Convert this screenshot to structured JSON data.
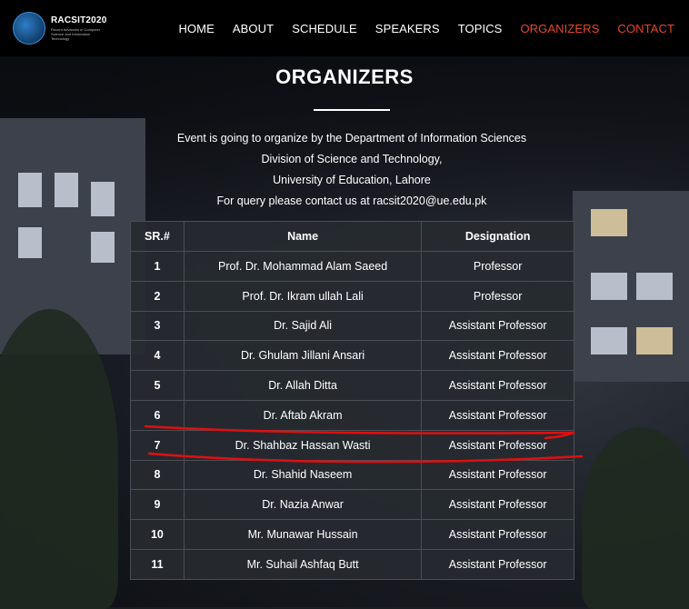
{
  "brand": {
    "title": "RACSIT2020",
    "subtitle": "Recent Advances in Computer Science and Information Technology"
  },
  "nav": {
    "items": [
      {
        "label": "HOME"
      },
      {
        "label": "ABOUT"
      },
      {
        "label": "SCHEDULE"
      },
      {
        "label": "SPEAKERS"
      },
      {
        "label": "TOPICS"
      },
      {
        "label": "ORGANIZERS",
        "active": true
      },
      {
        "label": "CONTACT"
      }
    ]
  },
  "page": {
    "heading": "ORGANIZERS",
    "intro": [
      "Event is going to organize by the Department of Information Sciences",
      "Division of Science and Technology,",
      "University of Education, Lahore",
      "For query please contact us at racsit2020@ue.edu.pk"
    ]
  },
  "table": {
    "headers": [
      "SR.#",
      "Name",
      "Designation"
    ],
    "rows": [
      {
        "sr": "1",
        "name": "Prof. Dr. Mohammad Alam Saeed",
        "designation": "Professor"
      },
      {
        "sr": "2",
        "name": "Prof. Dr. Ikram ullah Lali",
        "designation": "Professor"
      },
      {
        "sr": "3",
        "name": "Dr. Sajid Ali",
        "designation": "Assistant Professor"
      },
      {
        "sr": "4",
        "name": "Dr. Ghulam Jillani Ansari",
        "designation": "Assistant Professor"
      },
      {
        "sr": "5",
        "name": "Dr. Allah Ditta",
        "designation": "Assistant Professor"
      },
      {
        "sr": "6",
        "name": "Dr. Aftab Akram",
        "designation": "Assistant Professor"
      },
      {
        "sr": "7",
        "name": "Dr. Shahbaz Hassan Wasti",
        "designation": "Assistant Professor"
      },
      {
        "sr": "8",
        "name": "Dr. Shahid Naseem",
        "designation": "Assistant Professor"
      },
      {
        "sr": "9",
        "name": "Dr. Nazia Anwar",
        "designation": "Assistant Professor"
      },
      {
        "sr": "10",
        "name": "Mr. Munawar Hussain",
        "designation": "Assistant Professor"
      },
      {
        "sr": "11",
        "name": "Mr. Suhail Ashfaq Butt",
        "designation": "Assistant Professor"
      }
    ]
  },
  "colors": {
    "accent": "#e8452c",
    "annotation": "#e01010"
  }
}
